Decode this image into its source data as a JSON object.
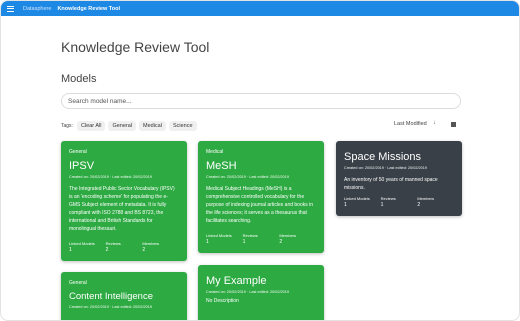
{
  "header": {
    "breadcrumb": "Datasphere",
    "app_title": "Knowledge Review Tool"
  },
  "page_title": "Knowledge Review Tool",
  "section_title": "Models",
  "search": {
    "placeholder": "Search model name..."
  },
  "tags": {
    "label": "Tags:",
    "items": [
      "Clear All",
      "General",
      "Medical",
      "Science"
    ]
  },
  "sort": {
    "label": "Last Modified",
    "direction_glyph": "↓"
  },
  "stat_labels": {
    "linked": "Linked Models",
    "reviews": "Reviews",
    "members": "Members"
  },
  "cards": [
    {
      "category": "General",
      "name": "IPSV",
      "dates": "Created on: 20/02/2019 · Last edited: 20/02/2019",
      "description": "The Integrated Public Sector Vocabulary (IPSV) is an 'encoding scheme' for populating the e-GMS Subject element of metadata. It is fully compliant with ISO 2788 and BS 8723, the international and British Standards for monolingual thesauri.",
      "linked": "1",
      "reviews": "2",
      "members": "2"
    },
    {
      "category": "Medical",
      "name": "MeSH",
      "dates": "Created on: 20/02/2019 · Last edited: 20/02/2019",
      "description": "Medical Subject Headings (MeSH) is a comprehensive controlled vocabulary for the purpose of indexing journal articles and books in the life sciences; it serves as a thesaurus that facilitates searching.",
      "linked": "1",
      "reviews": "1",
      "members": "2"
    },
    {
      "category": "",
      "name": "Space Missions",
      "dates": "Created on: 20/02/2019 · Last edited: 20/02/2019",
      "description": "An inventory of 50 years of manned space missions.",
      "linked": "1",
      "reviews": "1",
      "members": "2"
    },
    {
      "category": "General",
      "name": "Content Intelligence",
      "dates": "Created on: 20/02/2019 · Last edited: 20/02/2019",
      "description": ""
    },
    {
      "category": "",
      "name": "My Example",
      "dates": "Created on: 20/02/2019 · Last edited: 20/02/2019",
      "description": "No Description"
    }
  ],
  "colors": {
    "topbar": "#1e88e5",
    "card_green": "#2eaa43",
    "card_dark": "#394047"
  }
}
